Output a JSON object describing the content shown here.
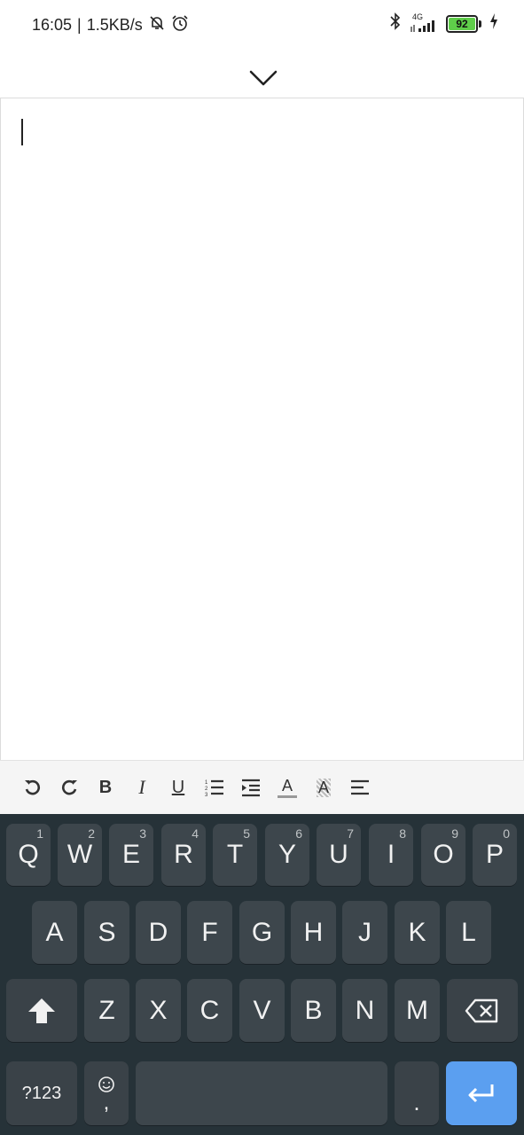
{
  "status": {
    "time": "16:05",
    "net_speed": "1.5KB/s",
    "network": "4G",
    "battery": "92"
  },
  "toolbar_items": [
    {
      "name": "undo-button",
      "icon": "undo-icon"
    },
    {
      "name": "redo-button",
      "icon": "redo-icon"
    },
    {
      "name": "bold-button",
      "label": "B"
    },
    {
      "name": "italic-button",
      "label": "I"
    },
    {
      "name": "underline-button",
      "label": "U"
    },
    {
      "name": "numbered-list-button",
      "icon": "numbered-list-icon"
    },
    {
      "name": "indent-button",
      "icon": "indent-icon"
    },
    {
      "name": "text-color-button",
      "label": "A"
    },
    {
      "name": "highlight-button",
      "label": "A"
    },
    {
      "name": "align-button",
      "icon": "align-icon"
    }
  ],
  "keyboard": {
    "row1": [
      {
        "label": "Q",
        "hint": "1"
      },
      {
        "label": "W",
        "hint": "2"
      },
      {
        "label": "E",
        "hint": "3"
      },
      {
        "label": "R",
        "hint": "4"
      },
      {
        "label": "T",
        "hint": "5"
      },
      {
        "label": "Y",
        "hint": "6"
      },
      {
        "label": "U",
        "hint": "7"
      },
      {
        "label": "I",
        "hint": "8"
      },
      {
        "label": "O",
        "hint": "9"
      },
      {
        "label": "P",
        "hint": "0"
      }
    ],
    "row2": [
      "A",
      "S",
      "D",
      "F",
      "G",
      "H",
      "J",
      "K",
      "L"
    ],
    "row3": [
      "Z",
      "X",
      "C",
      "V",
      "B",
      "N",
      "M"
    ],
    "symbols_label": "?123",
    "comma_label": ",",
    "period_label": "."
  },
  "colors": {
    "keyboard_bg": "#263238",
    "key_bg": "#3d464c",
    "enter_bg": "#5b9ff0"
  }
}
